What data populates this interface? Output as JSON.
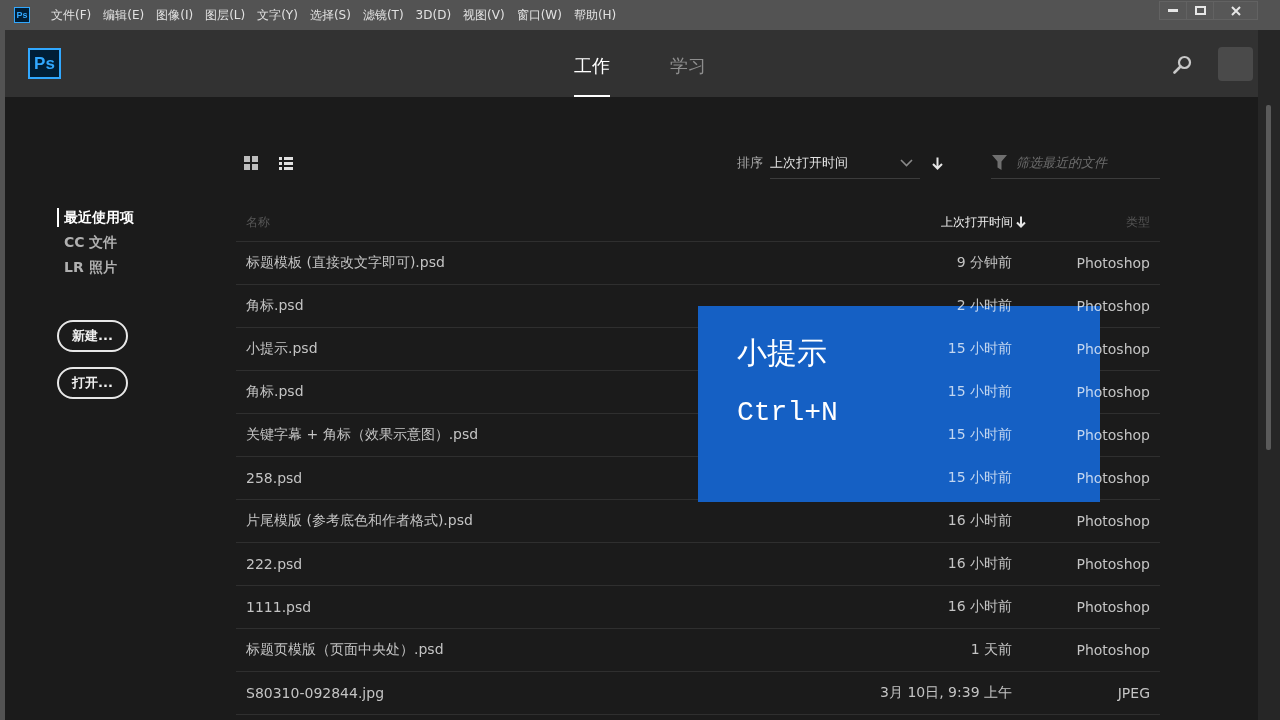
{
  "menu_bar": {
    "app_icon": "Ps",
    "items": [
      "文件(F)",
      "编辑(E)",
      "图像(I)",
      "图层(L)",
      "文字(Y)",
      "选择(S)",
      "滤镜(T)",
      "3D(D)",
      "视图(V)",
      "窗口(W)",
      "帮助(H)"
    ]
  },
  "header": {
    "logo": "Ps",
    "tabs": [
      {
        "label": "工作",
        "selected": true
      },
      {
        "label": "学习",
        "selected": false
      }
    ]
  },
  "sidebar": {
    "items": [
      {
        "label": "最近使用项",
        "selected": true
      },
      {
        "label": "CC 文件",
        "selected": false
      },
      {
        "label": "LR 照片",
        "selected": false
      }
    ],
    "buttons": [
      "新建...",
      "打开..."
    ]
  },
  "toolbar": {
    "sort_label": "排序",
    "sort_value": "上次打开时间",
    "filter": {
      "placeholder": "筛选最近的文件"
    }
  },
  "table": {
    "columns": [
      {
        "label": "名称",
        "sorted": false
      },
      {
        "label": "上次打开时间",
        "sorted": true
      },
      {
        "label": "类型",
        "sorted": false
      }
    ],
    "rows": [
      {
        "name": "标题模板 (直接改文字即可).psd",
        "time": "9 分钟前",
        "type": "Photoshop"
      },
      {
        "name": "角标.psd",
        "time": "2 小时前",
        "type": "Photoshop"
      },
      {
        "name": "小提示.psd",
        "time": "15 小时前",
        "type": "Photoshop"
      },
      {
        "name": "角标.psd",
        "time": "15 小时前",
        "type": "Photoshop"
      },
      {
        "name": "关键字幕 + 角标（效果示意图）.psd",
        "time": "15 小时前",
        "type": "Photoshop"
      },
      {
        "name": "258.psd",
        "time": "15 小时前",
        "type": "Photoshop"
      },
      {
        "name": "片尾模版 (参考底色和作者格式).psd",
        "time": "16 小时前",
        "type": "Photoshop"
      },
      {
        "name": "222.psd",
        "time": "16 小时前",
        "type": "Photoshop"
      },
      {
        "name": "1111.psd",
        "time": "16 小时前",
        "type": "Photoshop"
      },
      {
        "name": "标题页模版（页面中央处）.psd",
        "time": "1 天前",
        "type": "Photoshop"
      },
      {
        "name": "S80310-092844.jpg",
        "time": "3月 10日, 9:39 上午",
        "type": "JPEG"
      }
    ]
  },
  "tip": {
    "title": "小提示",
    "shortcut": "Ctrl+N"
  }
}
